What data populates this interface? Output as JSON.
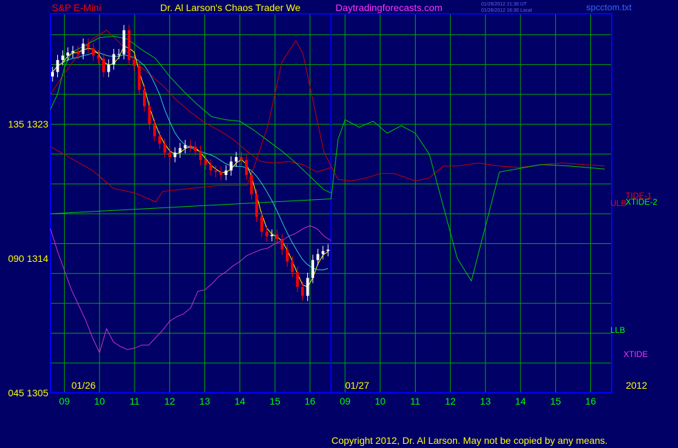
{
  "header": {
    "symbol": "S&P E-Mini",
    "title": "Dr. Al Larson's Chaos Trader We",
    "site": "Daytradingforecasts.com",
    "time_utc": "01/26/2012 21:30 UT",
    "time_local": "01/26/2012 16:30 Local",
    "file": "spcctom.txt"
  },
  "footer": {
    "copyright": "Copyright 2012, Dr. Al Larson. May not be copied by any means."
  },
  "colors": {
    "background": "#000066",
    "grid": "#00aa00",
    "border": "#0000ff",
    "bar_up": "#ffffff",
    "bar_down": "#ff0000",
    "tide1": "#cc0000",
    "tide2": "#00cc00",
    "ulb": "#cc0000",
    "llb": "#00cc00",
    "ma_fast": "#ffff00",
    "ma_slow": "#33cccc",
    "xtide": "#cc33cc"
  },
  "chart_data": {
    "type": "line",
    "title": "S&P E-Mini",
    "y_tick_labels": [
      {
        "label": "135 1323",
        "value": 1323
      },
      {
        "label": "090 1314",
        "value": 1314
      },
      {
        "label": "045 1305",
        "value": 1305
      }
    ],
    "ylim": [
      1305,
      1330.4
    ],
    "x_hours": [
      "09",
      "10",
      "11",
      "12",
      "13",
      "14",
      "15",
      "16",
      "09",
      "10",
      "11",
      "12",
      "13",
      "14",
      "15",
      "16"
    ],
    "date_labels": [
      "01/26",
      "01/27",
      "2012"
    ],
    "grid": true,
    "legend": {
      "tide1": "TIDE-1",
      "ulb": "ULB",
      "xtide2": "XTIDE-2",
      "llb": "LLB",
      "xtide": "XTIDE"
    },
    "price_close": [
      1326.5,
      1327.3,
      1327.6,
      1327.8,
      1327.9,
      1327.7,
      1328.4,
      1328.1,
      1327.6,
      1327.4,
      1326.5,
      1327.0,
      1327.7,
      1327.7,
      1329.3,
      1327.3,
      1326.9,
      1325.3,
      1324.2,
      1323.0,
      1322.2,
      1321.7,
      1321.1,
      1320.8,
      1321.1,
      1321.4,
      1321.6,
      1321.5,
      1321.2,
      1320.6,
      1320.3,
      1319.9,
      1319.8,
      1319.6,
      1319.9,
      1320.5,
      1320.8,
      1320.6,
      1319.6,
      1318.3,
      1316.8,
      1315.8,
      1315.5,
      1315.6,
      1315.3,
      1314.6,
      1313.8,
      1313.1,
      1312.1,
      1311.5,
      1312.7,
      1313.9,
      1314.3,
      1314.5,
      1314.6
    ],
    "series": [
      {
        "name": "TIDE-1",
        "x": [
          0,
          3,
          6,
          8,
          9,
          12,
          14,
          15,
          16,
          20,
          24,
          28,
          29,
          31,
          33,
          35,
          36,
          37,
          39,
          41,
          43,
          45,
          47,
          49,
          52,
          54,
          56,
          58,
          61,
          64,
          67,
          70,
          73,
          76,
          79
        ],
        "y": [
          1321.5,
          1320.7,
          1319.9,
          1319.1,
          1318.7,
          1318.4,
          1318.0,
          1317.8,
          1318.5,
          1318.7,
          1318.9,
          1318.9,
          1320.1,
          1322.9,
          1327.2,
          1328.6,
          1327.7,
          1325.5,
          1321.1,
          1319.3,
          1319.2,
          1319.4,
          1319.7,
          1319.7,
          1319.2,
          1319.4,
          1320.2,
          1320.2,
          1320.4,
          1320.2,
          1320.1,
          1320.3,
          1320.4,
          1320.3,
          1320.2
        ]
      },
      {
        "name": "XTIDE-2",
        "x": [
          0,
          40,
          41,
          42,
          44,
          46,
          48,
          50,
          52,
          54,
          56,
          58,
          60,
          64,
          70,
          74,
          79
        ],
        "y": [
          1317.0,
          1318.0,
          1322.0,
          1323.3,
          1322.8,
          1323.2,
          1322.4,
          1322.9,
          1322.4,
          1321.0,
          1317.5,
          1314.0,
          1312.5,
          1319.8,
          1320.3,
          1320.2,
          1320.0
        ]
      },
      {
        "name": "ULB",
        "x": [
          0,
          2,
          4,
          6,
          8,
          10,
          12,
          14,
          16,
          18,
          20,
          22,
          24,
          26,
          28,
          30,
          32,
          34,
          36,
          38,
          40
        ],
        "y": [
          1325.0,
          1326.4,
          1327.7,
          1328.7,
          1329.3,
          1328.4,
          1327.2,
          1326.4,
          1325.6,
          1324.6,
          1323.8,
          1323.1,
          1322.6,
          1322.0,
          1321.2,
          1320.5,
          1320.4,
          1320.5,
          1320.3,
          1319.8,
          1320.1
        ]
      },
      {
        "name": "LLB",
        "x": [
          0,
          1,
          2,
          3,
          5,
          7,
          9,
          11,
          13,
          15,
          17,
          19,
          21,
          23,
          25,
          27,
          29,
          31,
          33,
          35,
          37,
          39,
          40
        ],
        "y": [
          1324.0,
          1325.0,
          1326.8,
          1327.8,
          1328.3,
          1328.8,
          1328.9,
          1328.7,
          1328.0,
          1327.4,
          1326.2,
          1325.2,
          1324.3,
          1323.5,
          1323.3,
          1323.2,
          1322.6,
          1321.9,
          1321.2,
          1320.4,
          1319.5,
          1318.6,
          1318.4
        ]
      },
      {
        "name": "XTIDE",
        "x": [
          0,
          1,
          2,
          3,
          4,
          5,
          6,
          7,
          8,
          9,
          10,
          11,
          12,
          13,
          14,
          15,
          16,
          17,
          18,
          19,
          20,
          21,
          22,
          23,
          24,
          25,
          26,
          27,
          28,
          29,
          30,
          31,
          32,
          33,
          34,
          35,
          36,
          37,
          38,
          39,
          40
        ],
        "y": [
          1316.0,
          1314.5,
          1313.2,
          1311.9,
          1310.9,
          1309.9,
          1308.7,
          1307.7,
          1309.3,
          1308.4,
          1308.1,
          1307.9,
          1308.0,
          1308.2,
          1308.2,
          1308.7,
          1309.2,
          1309.8,
          1310.1,
          1310.3,
          1310.7,
          1311.8,
          1311.9,
          1312.3,
          1312.8,
          1313.1,
          1313.5,
          1313.8,
          1314.2,
          1314.4,
          1314.6,
          1314.7,
          1315.0,
          1315.2,
          1315.5,
          1315.7,
          1316.0,
          1316.2,
          1316.0,
          1315.5,
          1315.2
        ]
      }
    ],
    "x_units": "15-minute bars from 01/26 08:30 (20 bars per session, day 2 starts at bar 40)"
  }
}
